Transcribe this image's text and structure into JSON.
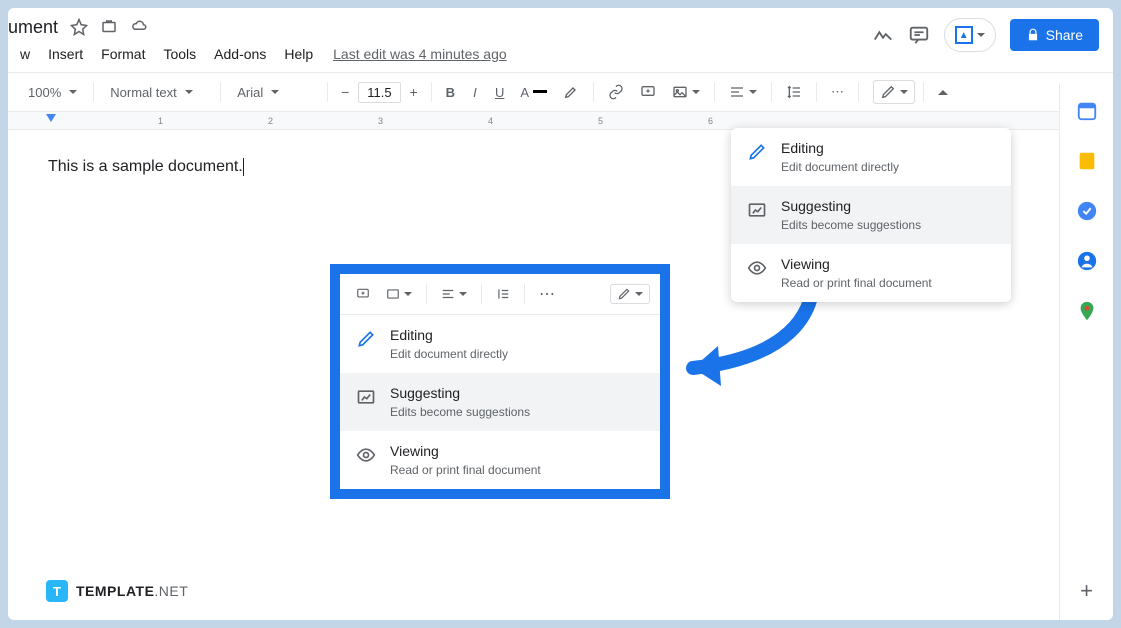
{
  "title_fragment": "ument",
  "menu": {
    "w": "w",
    "insert": "Insert",
    "format": "Format",
    "tools": "Tools",
    "addons": "Add-ons",
    "help": "Help"
  },
  "last_edit": "Last edit was 4 minutes ago",
  "share_label": "Share",
  "toolbar": {
    "zoom": "100%",
    "style": "Normal text",
    "font": "Arial",
    "fontsize": "11.5",
    "bold": "B",
    "italic": "I",
    "underline": "U",
    "textcolor": "A"
  },
  "doc_text": "This is a sample document.",
  "modes": {
    "editing": {
      "label": "Editing",
      "desc": "Edit document directly"
    },
    "suggesting": {
      "label": "Suggesting",
      "desc": "Edits become suggestions"
    },
    "viewing": {
      "label": "Viewing",
      "desc": "Read or print final document"
    }
  },
  "brand": {
    "badge": "T",
    "name": "TEMPLATE",
    "suffix": ".NET"
  },
  "ruler": [
    "1",
    "2",
    "3",
    "4",
    "5",
    "6"
  ]
}
